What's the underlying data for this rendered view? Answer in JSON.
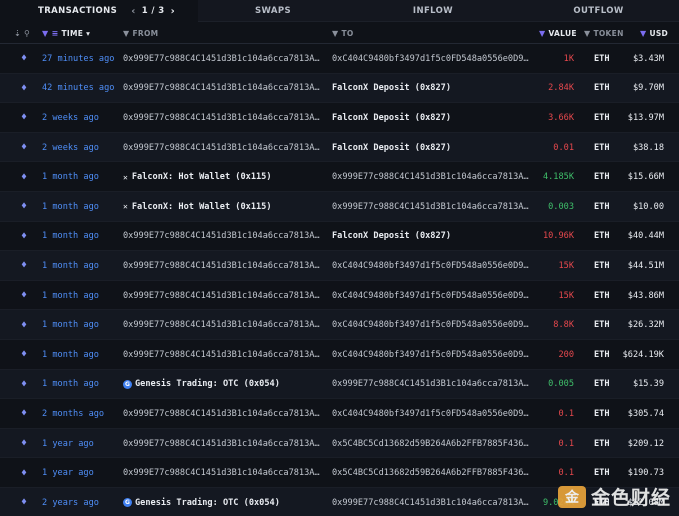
{
  "tabs": {
    "transactions": "TRANSACTIONS",
    "pager": "1 / 3",
    "swaps": "SWAPS",
    "inflow": "INFLOW",
    "outflow": "OUTFLOW"
  },
  "columns": {
    "time": "TIME",
    "from": "FROM",
    "to": "TO",
    "value": "VALUE",
    "token": "TOKEN",
    "usd": "USD"
  },
  "colors": {
    "accent": "#4f8ef7",
    "negative": "#e5484d",
    "positive": "#3fbf6a",
    "filter": "#7b6df0"
  },
  "rows": [
    {
      "time": "27 minutes ago",
      "from": "0x999E77c988C4C1451d3B1c104a6cca7813A…",
      "to": "0xC404C9480bf3497d1f5c0FD548a0556e0D9…",
      "value": "1K",
      "dir": "neg",
      "token": "ETH",
      "usd": "$3.43M"
    },
    {
      "time": "42 minutes ago",
      "from": "0x999E77c988C4C1451d3B1c104a6cca7813A…",
      "to": "FalconX Deposit (0x827)",
      "value": "2.84K",
      "dir": "neg",
      "token": "ETH",
      "usd": "$9.70M"
    },
    {
      "time": "2 weeks ago",
      "from": "0x999E77c988C4C1451d3B1c104a6cca7813A…",
      "to": "FalconX Deposit (0x827)",
      "value": "3.66K",
      "dir": "neg",
      "token": "ETH",
      "usd": "$13.97M"
    },
    {
      "time": "2 weeks ago",
      "from": "0x999E77c988C4C1451d3B1c104a6cca7813A…",
      "to": "FalconX Deposit (0x827)",
      "value": "0.01",
      "dir": "neg",
      "token": "ETH",
      "usd": "$38.18"
    },
    {
      "time": "1 month ago",
      "from": "FalconX: Hot Wallet (0x115)",
      "to": "0x999E77c988C4C1451d3B1c104a6cca7813A…",
      "value": "4.185K",
      "dir": "pos",
      "token": "ETH",
      "usd": "$15.66M"
    },
    {
      "time": "1 month ago",
      "from": "FalconX: Hot Wallet (0x115)",
      "to": "0x999E77c988C4C1451d3B1c104a6cca7813A…",
      "value": "0.003",
      "dir": "pos",
      "token": "ETH",
      "usd": "$10.00"
    },
    {
      "time": "1 month ago",
      "from": "0x999E77c988C4C1451d3B1c104a6cca7813A…",
      "to": "FalconX Deposit (0x827)",
      "value": "10.96K",
      "dir": "neg",
      "token": "ETH",
      "usd": "$40.44M"
    },
    {
      "time": "1 month ago",
      "from": "0x999E77c988C4C1451d3B1c104a6cca7813A…",
      "to": "0xC404C9480bf3497d1f5c0FD548a0556e0D9…",
      "value": "15K",
      "dir": "neg",
      "token": "ETH",
      "usd": "$44.51M"
    },
    {
      "time": "1 month ago",
      "from": "0x999E77c988C4C1451d3B1c104a6cca7813A…",
      "to": "0xC404C9480bf3497d1f5c0FD548a0556e0D9…",
      "value": "15K",
      "dir": "neg",
      "token": "ETH",
      "usd": "$43.86M"
    },
    {
      "time": "1 month ago",
      "from": "0x999E77c988C4C1451d3B1c104a6cca7813A…",
      "to": "0xC404C9480bf3497d1f5c0FD548a0556e0D9…",
      "value": "8.8K",
      "dir": "neg",
      "token": "ETH",
      "usd": "$26.32M"
    },
    {
      "time": "1 month ago",
      "from": "0x999E77c988C4C1451d3B1c104a6cca7813A…",
      "to": "0xC404C9480bf3497d1f5c0FD548a0556e0D9…",
      "value": "200",
      "dir": "neg",
      "token": "ETH",
      "usd": "$624.19K"
    },
    {
      "time": "1 month ago",
      "from": "Genesis Trading: OTC (0x054)",
      "to": "0x999E77c988C4C1451d3B1c104a6cca7813A…",
      "value": "0.005",
      "dir": "pos",
      "token": "ETH",
      "usd": "$15.39"
    },
    {
      "time": "2 months ago",
      "from": "0x999E77c988C4C1451d3B1c104a6cca7813A…",
      "to": "0xC404C9480bf3497d1f5c0FD548a0556e0D9…",
      "value": "0.1",
      "dir": "neg",
      "token": "ETH",
      "usd": "$305.74"
    },
    {
      "time": "1 year ago",
      "from": "0x999E77c988C4C1451d3B1c104a6cca7813A…",
      "to": "0x5C4BC5Cd13682d59B264A6b2FFB7885F436…",
      "value": "0.1",
      "dir": "neg",
      "token": "ETH",
      "usd": "$209.12"
    },
    {
      "time": "1 year ago",
      "from": "0x999E77c988C4C1451d3B1c104a6cca7813A…",
      "to": "0x5C4BC5Cd13682d59B264A6b2FFB7885F436…",
      "value": "0.1",
      "dir": "neg",
      "token": "ETH",
      "usd": "$190.73"
    },
    {
      "time": "2 years ago",
      "from": "Genesis Trading: OTC (0x054)",
      "to": "0x999E77c988C4C1451d3B1c104a6cca7813A…",
      "value": "9.024K",
      "dir": "pos",
      "token": "ETH",
      "usd": "$12.08M"
    }
  ],
  "watermark": {
    "logo": "金",
    "text": "金色财经"
  }
}
